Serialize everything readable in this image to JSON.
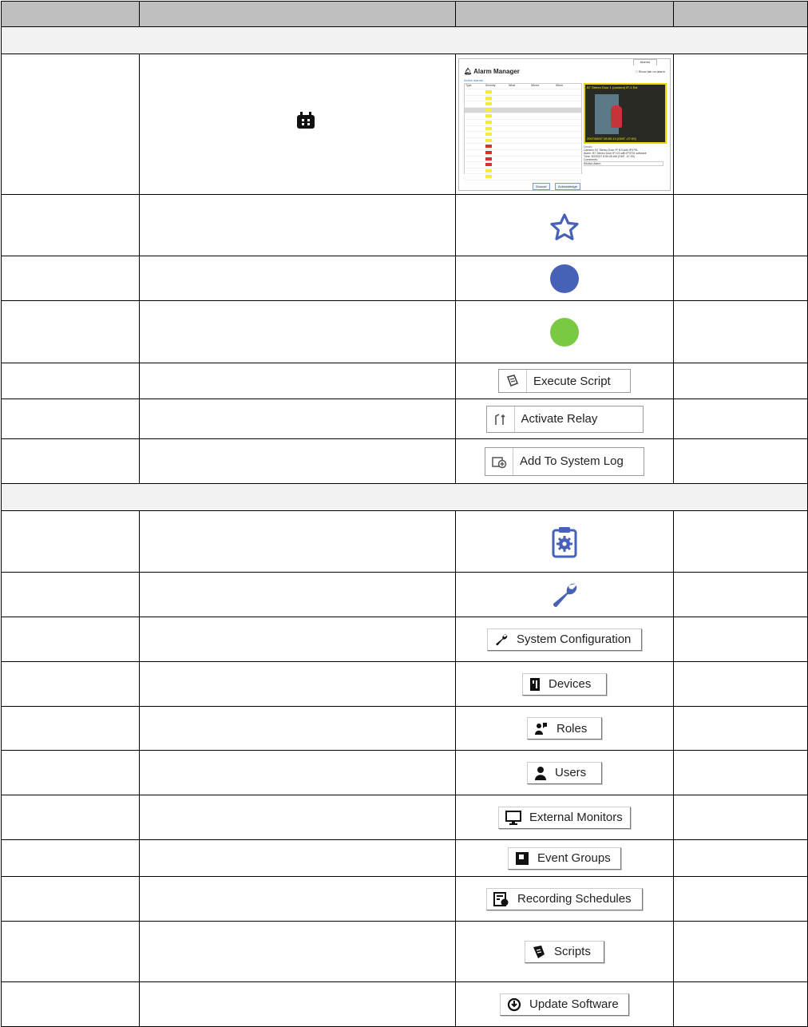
{
  "alarm_manager": {
    "tab_label": "Alarms",
    "title": "Alarm Manager",
    "show_tab_label": "Show tab on alarm",
    "active_alarms_label": "Active alarms",
    "columns": [
      "Type",
      "Severity",
      "What",
      "Where",
      "When"
    ],
    "video_caption": "B7 Stereo Door 1 (camera) IP-1 Ext",
    "video_timestamp": "2007/08/07 08:50:13 (GMT -07:00)",
    "details_heading": "Details",
    "details_camera": "Camera: B7 Stereo Door IP f13 with IP3791",
    "details_alarm": "Alarm: B7 Stereo Door IP f13 with IP3791 software",
    "details_time": "Time: 8/2/2007 8:50:05 AM (GMT -07:00)",
    "details_comments": "Comments:",
    "details_motion": "Motion Alarm",
    "snooze_label": "Snooze",
    "acknowledge_label": "Acknowledge"
  },
  "buttons": {
    "execute_script": "Execute Script",
    "activate_relay": "Activate Relay",
    "add_to_system_log": "Add To System Log",
    "system_configuration": "System Configuration",
    "devices": "Devices",
    "roles": "Roles",
    "users": "Users",
    "external_monitors": "External Monitors",
    "event_groups": "Event Groups",
    "recording_schedules": "Recording Schedules",
    "scripts": "Scripts",
    "update_software": "Update Software"
  },
  "colors": {
    "header_bg": "#bfbfbf",
    "section_bg": "#f2f2f2",
    "icon_blue": "#4761b7",
    "green_dot": "#7ac943",
    "severity_yellow": "#f2ec3c",
    "severity_red": "#d9302c"
  }
}
